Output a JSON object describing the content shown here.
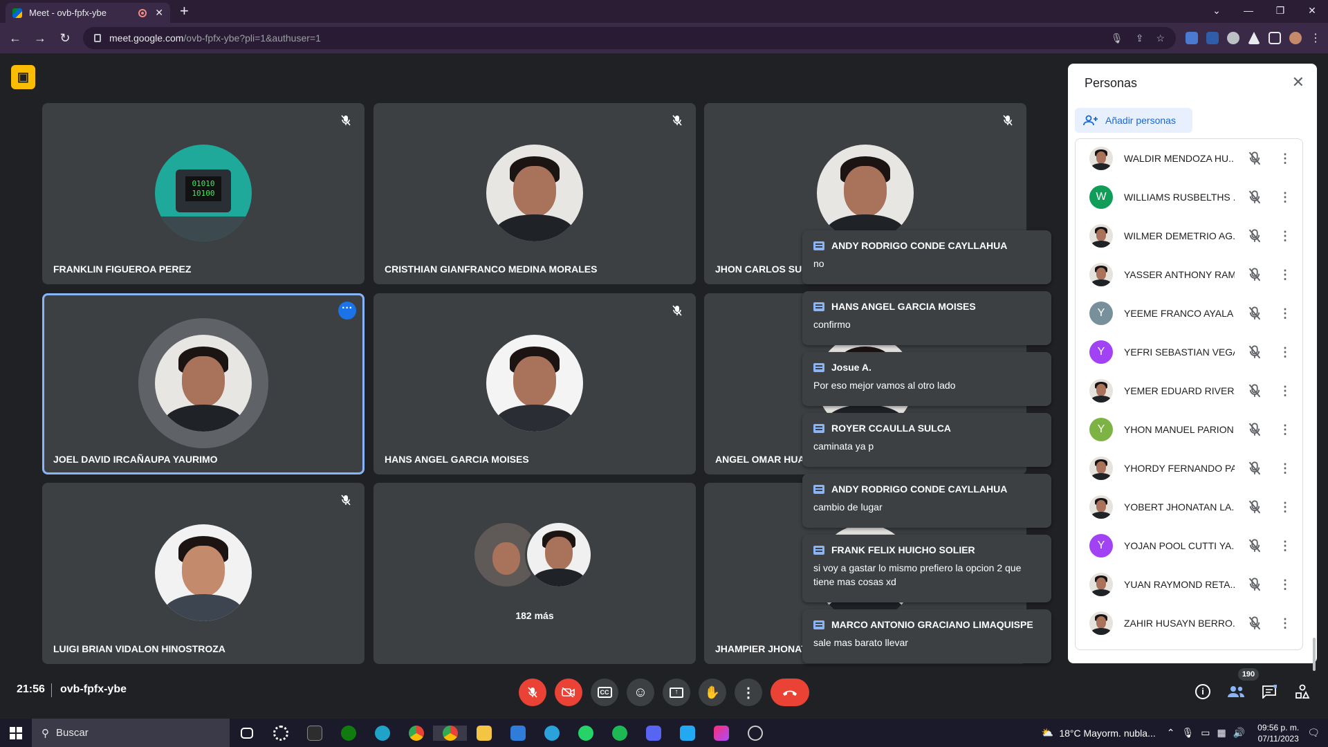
{
  "browser": {
    "tab_title": "Meet - ovb-fpfx-ybe",
    "url_host": "meet.google.com",
    "url_path": "/ovb-fpfx-ybe?pli=1&authuser=1"
  },
  "tiles": [
    {
      "name": "FRANKLIN FIGUEROA PEREZ"
    },
    {
      "name": "CRISTHIAN GIANFRANCO MEDINA MORALES"
    },
    {
      "name": "JHON CARLOS SUL"
    },
    {
      "name": "JOEL DAVID IRCAÑAUPA YAURIMO"
    },
    {
      "name": "HANS ANGEL GARCIA MOISES"
    },
    {
      "name": "ANGEL OMAR HUA"
    },
    {
      "name": "LUIGI BRIAN VIDALON HINOSTROZA"
    },
    {
      "more_label": "182 más"
    },
    {
      "name": "JHAMPIER JHONAT"
    }
  ],
  "chat_toasts": [
    {
      "sender": "ANDY RODRIGO CONDE CAYLLAHUA",
      "message": "no"
    },
    {
      "sender": "HANS ANGEL GARCIA MOISES",
      "message": "confirmo"
    },
    {
      "sender": "Josue A.",
      "message": "Por eso mejor vamos al otro lado"
    },
    {
      "sender": "ROYER CCAULLA SULCA",
      "message": "caminata ya p"
    },
    {
      "sender": "ANDY RODRIGO CONDE CAYLLAHUA",
      "message": "cambio de lugar"
    },
    {
      "sender": "FRANK FELIX HUICHO SOLIER",
      "message": "si voy a gastar lo mismo prefiero la opcion 2 que tiene mas cosas xd"
    },
    {
      "sender": "MARCO ANTONIO GRACIANO LIMAQUISPE",
      "message": "sale mas barato llevar"
    }
  ],
  "people_panel": {
    "title": "Personas",
    "add_label": "Añadir personas",
    "people": [
      {
        "name": "WALDIR MENDOZA HU...",
        "avatar": "photo"
      },
      {
        "name": "WILLIAMS RUSBELTHS ...",
        "avatar": "W",
        "color": "#0f9d58"
      },
      {
        "name": "WILMER DEMETRIO AG...",
        "avatar": "photo"
      },
      {
        "name": "YASSER ANTHONY RAM...",
        "avatar": "photo"
      },
      {
        "name": "YEEME FRANCO AYALA ...",
        "avatar": "Y",
        "color": "#78909c"
      },
      {
        "name": "YEFRI SEBASTIAN VEGA ...",
        "avatar": "Y",
        "color": "#a142f4"
      },
      {
        "name": "YEMER EDUARD RIVERA...",
        "avatar": "photo"
      },
      {
        "name": "YHON MANUEL PARION...",
        "avatar": "Y",
        "color": "#7cb342"
      },
      {
        "name": "YHORDY FERNANDO PA...",
        "avatar": "photo"
      },
      {
        "name": "YOBERT JHONATAN LA...",
        "avatar": "photo"
      },
      {
        "name": "YOJAN POOL CUTTI YA...",
        "avatar": "Y",
        "color": "#a142f4"
      },
      {
        "name": "YUAN RAYMOND RETA...",
        "avatar": "photo"
      },
      {
        "name": "ZAHIR HUSAYN BERRO...",
        "avatar": "photo"
      }
    ]
  },
  "bottom_bar": {
    "time": "21:56",
    "meeting_code": "ovb-fpfx-ybe",
    "people_count": "190"
  },
  "taskbar": {
    "search_placeholder": "Buscar",
    "weather": "18°C  Mayorm. nubla...",
    "clock_time": "09:56 p. m.",
    "clock_date": "07/11/2023"
  },
  "colors": {
    "meet_bg": "#202124",
    "tile_bg": "#3c4043",
    "accent_blue": "#8ab4f8",
    "end_call_red": "#ea4335",
    "browser_frame": "#3a2a48"
  }
}
